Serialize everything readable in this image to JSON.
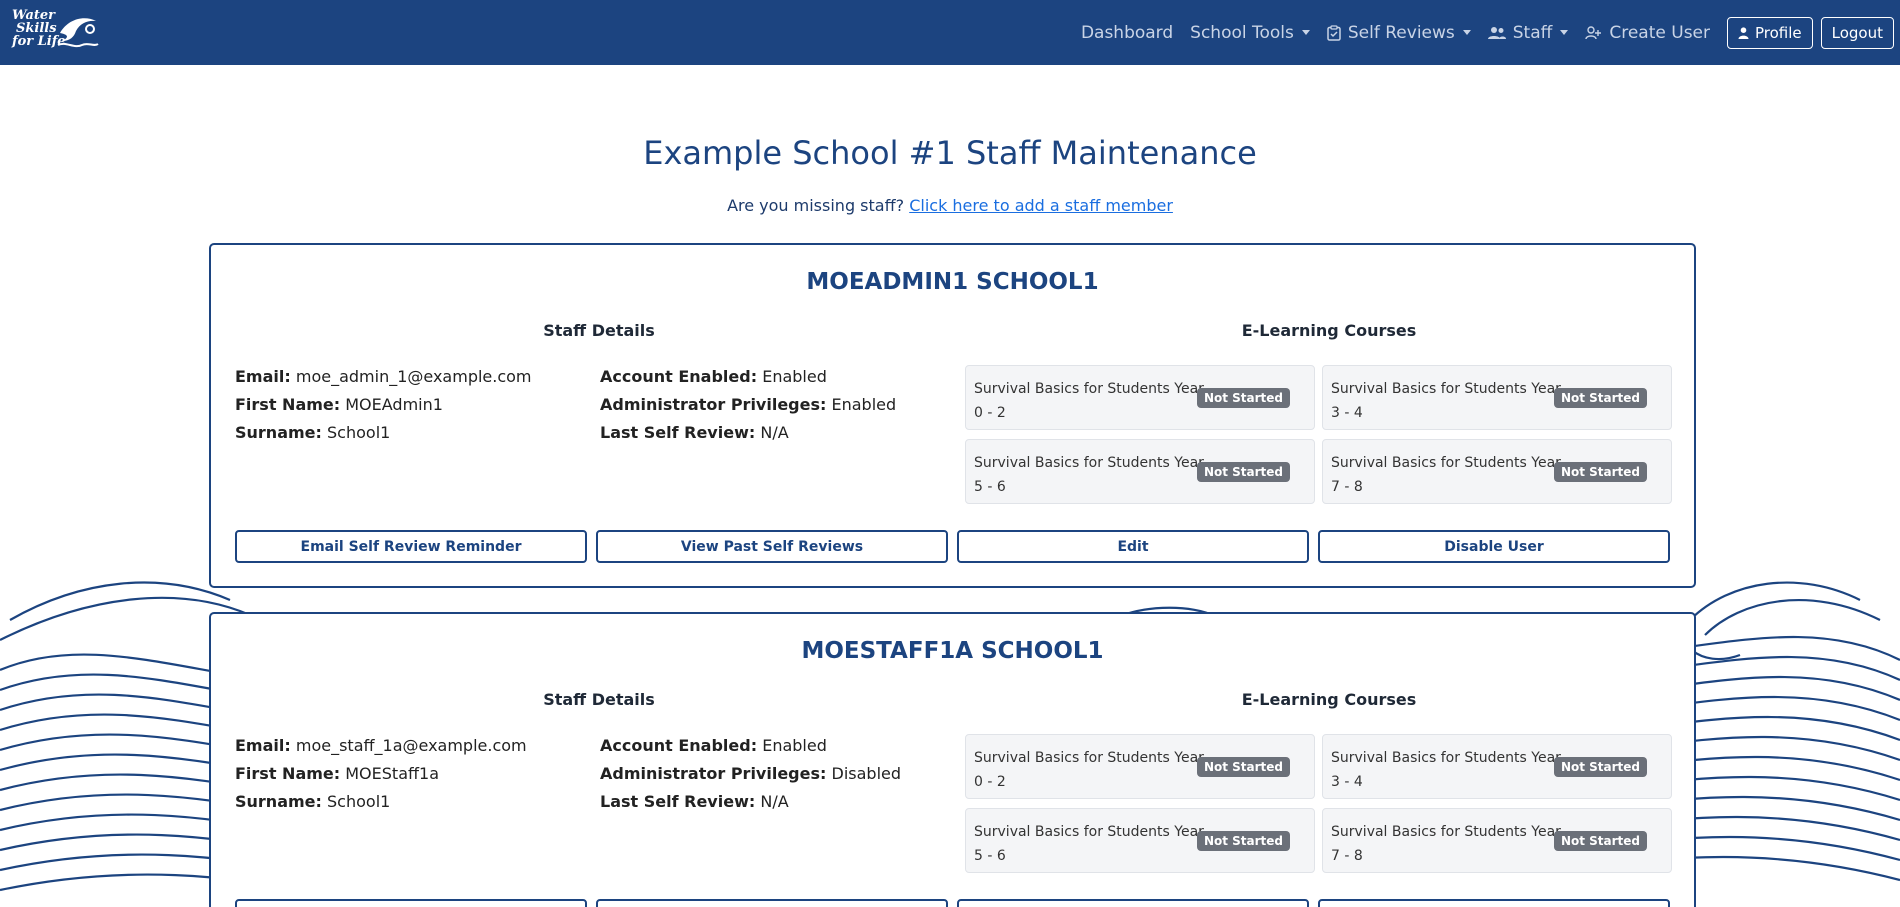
{
  "brand": {
    "line1": "Water",
    "line2": "Skills",
    "line3": "for Life"
  },
  "nav": {
    "dashboard": "Dashboard",
    "school_tools": "School Tools",
    "self_reviews": "Self Reviews",
    "staff": "Staff",
    "create_user": "Create User",
    "profile": "Profile",
    "logout": "Logout"
  },
  "page": {
    "title": "Example School #1 Staff Maintenance",
    "missing_text": "Are you missing staff?",
    "add_link": "Click here to add a staff member"
  },
  "labels": {
    "staff_details": "Staff Details",
    "courses": "E-Learning Courses",
    "email": "Email:",
    "first_name": "First Name:",
    "surname": "Surname:",
    "account_enabled": "Account Enabled:",
    "admin_privileges": "Administrator Privileges:",
    "last_review": "Last Self Review:"
  },
  "staff": [
    {
      "name": "MOEADMIN1 SCHOOL1",
      "email": "moe_admin_1@example.com",
      "first_name": "MOEAdmin1",
      "surname": "School1",
      "account_enabled": "Enabled",
      "admin_privileges": "Enabled",
      "last_review": "N/A",
      "courses": [
        {
          "name": "Survival Basics for Students Year 0 - 2",
          "status": "Not Started"
        },
        {
          "name": "Survival Basics for Students Year 3 - 4",
          "status": "Not Started"
        },
        {
          "name": "Survival Basics for Students Year 5 - 6",
          "status": "Not Started"
        },
        {
          "name": "Survival Basics for Students Year 7 - 8",
          "status": "Not Started"
        }
      ],
      "actions": [
        "Email Self Review Reminder",
        "View Past Self Reviews",
        "Edit",
        "Disable User"
      ]
    },
    {
      "name": "MOESTAFF1A SCHOOL1",
      "email": "moe_staff_1a@example.com",
      "first_name": "MOEStaff1a",
      "surname": "School1",
      "account_enabled": "Enabled",
      "admin_privileges": "Disabled",
      "last_review": "N/A",
      "courses": [
        {
          "name": "Survival Basics for Students Year 0 - 2",
          "status": "Not Started"
        },
        {
          "name": "Survival Basics for Students Year 3 - 4",
          "status": "Not Started"
        },
        {
          "name": "Survival Basics for Students Year 5 - 6",
          "status": "Not Started"
        },
        {
          "name": "Survival Basics for Students Year 7 - 8",
          "status": "Not Started"
        }
      ]
    }
  ],
  "colors": {
    "navbar": "#1c4480",
    "badge": "#6b7079",
    "link": "#1a6ee0"
  }
}
